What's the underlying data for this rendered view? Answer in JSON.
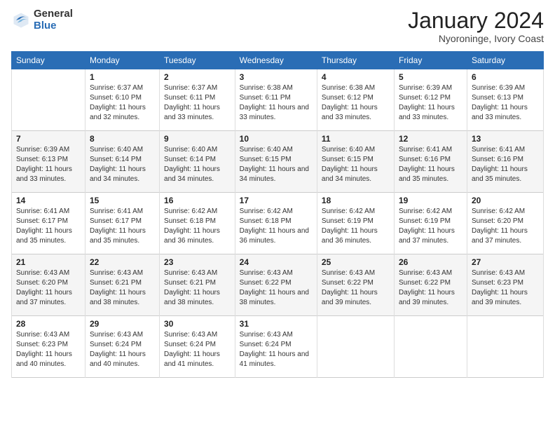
{
  "header": {
    "logo_general": "General",
    "logo_blue": "Blue",
    "title": "January 2024",
    "subtitle": "Nyoroninge, Ivory Coast"
  },
  "days_of_week": [
    "Sunday",
    "Monday",
    "Tuesday",
    "Wednesday",
    "Thursday",
    "Friday",
    "Saturday"
  ],
  "weeks": [
    [
      {
        "day": "",
        "sunrise": "",
        "sunset": "",
        "daylight": ""
      },
      {
        "day": "1",
        "sunrise": "Sunrise: 6:37 AM",
        "sunset": "Sunset: 6:10 PM",
        "daylight": "Daylight: 11 hours and 32 minutes."
      },
      {
        "day": "2",
        "sunrise": "Sunrise: 6:37 AM",
        "sunset": "Sunset: 6:11 PM",
        "daylight": "Daylight: 11 hours and 33 minutes."
      },
      {
        "day": "3",
        "sunrise": "Sunrise: 6:38 AM",
        "sunset": "Sunset: 6:11 PM",
        "daylight": "Daylight: 11 hours and 33 minutes."
      },
      {
        "day": "4",
        "sunrise": "Sunrise: 6:38 AM",
        "sunset": "Sunset: 6:12 PM",
        "daylight": "Daylight: 11 hours and 33 minutes."
      },
      {
        "day": "5",
        "sunrise": "Sunrise: 6:39 AM",
        "sunset": "Sunset: 6:12 PM",
        "daylight": "Daylight: 11 hours and 33 minutes."
      },
      {
        "day": "6",
        "sunrise": "Sunrise: 6:39 AM",
        "sunset": "Sunset: 6:13 PM",
        "daylight": "Daylight: 11 hours and 33 minutes."
      }
    ],
    [
      {
        "day": "7",
        "sunrise": "Sunrise: 6:39 AM",
        "sunset": "Sunset: 6:13 PM",
        "daylight": "Daylight: 11 hours and 33 minutes."
      },
      {
        "day": "8",
        "sunrise": "Sunrise: 6:40 AM",
        "sunset": "Sunset: 6:14 PM",
        "daylight": "Daylight: 11 hours and 34 minutes."
      },
      {
        "day": "9",
        "sunrise": "Sunrise: 6:40 AM",
        "sunset": "Sunset: 6:14 PM",
        "daylight": "Daylight: 11 hours and 34 minutes."
      },
      {
        "day": "10",
        "sunrise": "Sunrise: 6:40 AM",
        "sunset": "Sunset: 6:15 PM",
        "daylight": "Daylight: 11 hours and 34 minutes."
      },
      {
        "day": "11",
        "sunrise": "Sunrise: 6:40 AM",
        "sunset": "Sunset: 6:15 PM",
        "daylight": "Daylight: 11 hours and 34 minutes."
      },
      {
        "day": "12",
        "sunrise": "Sunrise: 6:41 AM",
        "sunset": "Sunset: 6:16 PM",
        "daylight": "Daylight: 11 hours and 35 minutes."
      },
      {
        "day": "13",
        "sunrise": "Sunrise: 6:41 AM",
        "sunset": "Sunset: 6:16 PM",
        "daylight": "Daylight: 11 hours and 35 minutes."
      }
    ],
    [
      {
        "day": "14",
        "sunrise": "Sunrise: 6:41 AM",
        "sunset": "Sunset: 6:17 PM",
        "daylight": "Daylight: 11 hours and 35 minutes."
      },
      {
        "day": "15",
        "sunrise": "Sunrise: 6:41 AM",
        "sunset": "Sunset: 6:17 PM",
        "daylight": "Daylight: 11 hours and 35 minutes."
      },
      {
        "day": "16",
        "sunrise": "Sunrise: 6:42 AM",
        "sunset": "Sunset: 6:18 PM",
        "daylight": "Daylight: 11 hours and 36 minutes."
      },
      {
        "day": "17",
        "sunrise": "Sunrise: 6:42 AM",
        "sunset": "Sunset: 6:18 PM",
        "daylight": "Daylight: 11 hours and 36 minutes."
      },
      {
        "day": "18",
        "sunrise": "Sunrise: 6:42 AM",
        "sunset": "Sunset: 6:19 PM",
        "daylight": "Daylight: 11 hours and 36 minutes."
      },
      {
        "day": "19",
        "sunrise": "Sunrise: 6:42 AM",
        "sunset": "Sunset: 6:19 PM",
        "daylight": "Daylight: 11 hours and 37 minutes."
      },
      {
        "day": "20",
        "sunrise": "Sunrise: 6:42 AM",
        "sunset": "Sunset: 6:20 PM",
        "daylight": "Daylight: 11 hours and 37 minutes."
      }
    ],
    [
      {
        "day": "21",
        "sunrise": "Sunrise: 6:43 AM",
        "sunset": "Sunset: 6:20 PM",
        "daylight": "Daylight: 11 hours and 37 minutes."
      },
      {
        "day": "22",
        "sunrise": "Sunrise: 6:43 AM",
        "sunset": "Sunset: 6:21 PM",
        "daylight": "Daylight: 11 hours and 38 minutes."
      },
      {
        "day": "23",
        "sunrise": "Sunrise: 6:43 AM",
        "sunset": "Sunset: 6:21 PM",
        "daylight": "Daylight: 11 hours and 38 minutes."
      },
      {
        "day": "24",
        "sunrise": "Sunrise: 6:43 AM",
        "sunset": "Sunset: 6:22 PM",
        "daylight": "Daylight: 11 hours and 38 minutes."
      },
      {
        "day": "25",
        "sunrise": "Sunrise: 6:43 AM",
        "sunset": "Sunset: 6:22 PM",
        "daylight": "Daylight: 11 hours and 39 minutes."
      },
      {
        "day": "26",
        "sunrise": "Sunrise: 6:43 AM",
        "sunset": "Sunset: 6:22 PM",
        "daylight": "Daylight: 11 hours and 39 minutes."
      },
      {
        "day": "27",
        "sunrise": "Sunrise: 6:43 AM",
        "sunset": "Sunset: 6:23 PM",
        "daylight": "Daylight: 11 hours and 39 minutes."
      }
    ],
    [
      {
        "day": "28",
        "sunrise": "Sunrise: 6:43 AM",
        "sunset": "Sunset: 6:23 PM",
        "daylight": "Daylight: 11 hours and 40 minutes."
      },
      {
        "day": "29",
        "sunrise": "Sunrise: 6:43 AM",
        "sunset": "Sunset: 6:24 PM",
        "daylight": "Daylight: 11 hours and 40 minutes."
      },
      {
        "day": "30",
        "sunrise": "Sunrise: 6:43 AM",
        "sunset": "Sunset: 6:24 PM",
        "daylight": "Daylight: 11 hours and 41 minutes."
      },
      {
        "day": "31",
        "sunrise": "Sunrise: 6:43 AM",
        "sunset": "Sunset: 6:24 PM",
        "daylight": "Daylight: 11 hours and 41 minutes."
      },
      {
        "day": "",
        "sunrise": "",
        "sunset": "",
        "daylight": ""
      },
      {
        "day": "",
        "sunrise": "",
        "sunset": "",
        "daylight": ""
      },
      {
        "day": "",
        "sunrise": "",
        "sunset": "",
        "daylight": ""
      }
    ]
  ]
}
